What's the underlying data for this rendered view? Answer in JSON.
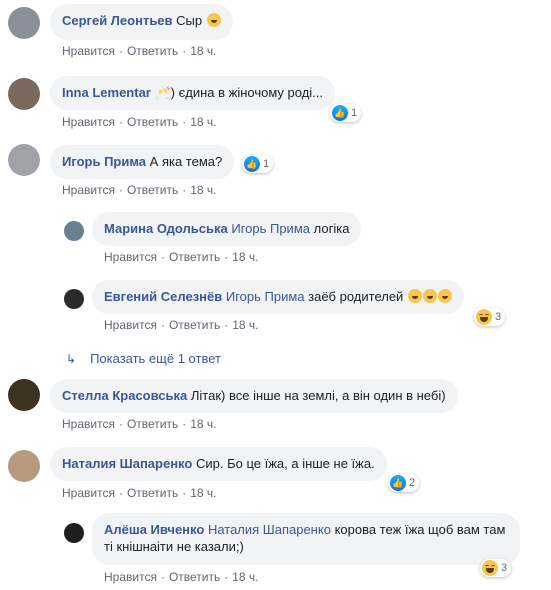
{
  "comments": [
    {
      "author": "Сергей Леонтьев",
      "text": "Сыр",
      "like": "Нравится",
      "reply": "Ответить",
      "time": "18 ч."
    },
    {
      "author": "Inna Lementar",
      "text": "🥂) єдина в жіночому роді...",
      "like": "Нравится",
      "reply": "Ответить",
      "time": "18 ч.",
      "reactions": "1"
    },
    {
      "author": "Игорь Прима",
      "text": "А яка тема?",
      "like": "Нравится",
      "reply": "Ответить",
      "time": "18 ч.",
      "reactions": "1"
    },
    {
      "author": "Марина Одольська",
      "mention": "Игорь Прима",
      "text": "логіка",
      "like": "Нравится",
      "reply": "Ответить",
      "time": "18 ч."
    },
    {
      "author": "Евгений Селезнёв",
      "mention": "Игорь Прима",
      "text": "заёб родителей",
      "like": "Нравится",
      "reply": "Ответить",
      "time": "18 ч.",
      "reactions": "3"
    },
    {
      "author": "Стелла Красовська",
      "text": "Літак) все інше на землі, а він один в небі)",
      "like": "Нравится",
      "reply": "Ответить",
      "time": "18 ч."
    },
    {
      "author": "Наталия Шапаренко",
      "text": "Сир. Бо це їжа, а інше не їжа.",
      "like": "Нравится",
      "reply": "Ответить",
      "time": "18 ч.",
      "reactions": "2"
    },
    {
      "author": "Алёша Ивченко",
      "mention": "Наталия Шапаренко",
      "text": "корова теж їжа щоб вам там ті кнішнаіти не казали;)",
      "like": "Нравится",
      "reply": "Ответить",
      "time": "18 ч.",
      "reactions": "3"
    }
  ],
  "more_replies": "Показать ещё 1 ответ",
  "colors": {
    "link": "#385898",
    "bubble": "#f2f3f5",
    "meta": "#606770"
  }
}
